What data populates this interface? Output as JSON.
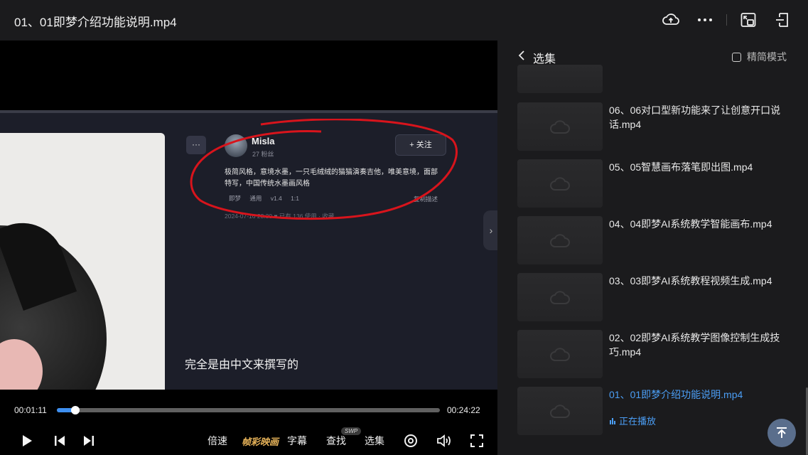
{
  "window": {
    "title": "01、01即梦介绍功能说明.mp4"
  },
  "topbar": {
    "icons": [
      "cloud-upload-icon",
      "more-icon",
      "picture-in-picture-icon",
      "exit-fullscreen-icon"
    ]
  },
  "video": {
    "frame": {
      "user_name": "Misla",
      "fans": "27 粉丝",
      "follow_label": "+ 关注",
      "more_label": "···",
      "prompt": "极简风格，意境水墨，一只毛绒绒的猫猫演奏吉他，唯美意境，面部特写，中国传统水墨画风格",
      "meta": "即梦 通用 v1.4    1:1",
      "copy_label": "复制描述",
      "date": "2024-07-16 23:30   ♥ 已有 136 使用 · 收藏",
      "subtitle": "完全是由中文来撰写的",
      "annotation_color": "#d8141c"
    }
  },
  "controls": {
    "current_time": "00:01:11",
    "total_time": "00:24:22",
    "progress": 0.049,
    "speed_label": "倍速",
    "film_label": "帧彩映画",
    "subtitle_label": "字幕",
    "search_label": "查找",
    "search_badge": "SWP",
    "episodes_label": "选集",
    "accent_color": "#3e8ff0",
    "film_color": "#e8b45a"
  },
  "sidebar": {
    "title": "选集",
    "mode_label": "精简模式",
    "episodes": [
      {
        "name": "06、06对口型新功能来了让创意开口说话.mp4"
      },
      {
        "name": "05、05智慧画布落笔即出图.mp4"
      },
      {
        "name": "04、04即梦AI系统教学智能画布.mp4"
      },
      {
        "name": "03、03即梦AI系统教程视频生成.mp4"
      },
      {
        "name": "02、02即梦AI系统教学图像控制生成技巧.mp4"
      },
      {
        "name": "01、01即梦介绍功能说明.mp4",
        "status": "正在播放"
      }
    ],
    "active_color": "#4b9ef5"
  }
}
